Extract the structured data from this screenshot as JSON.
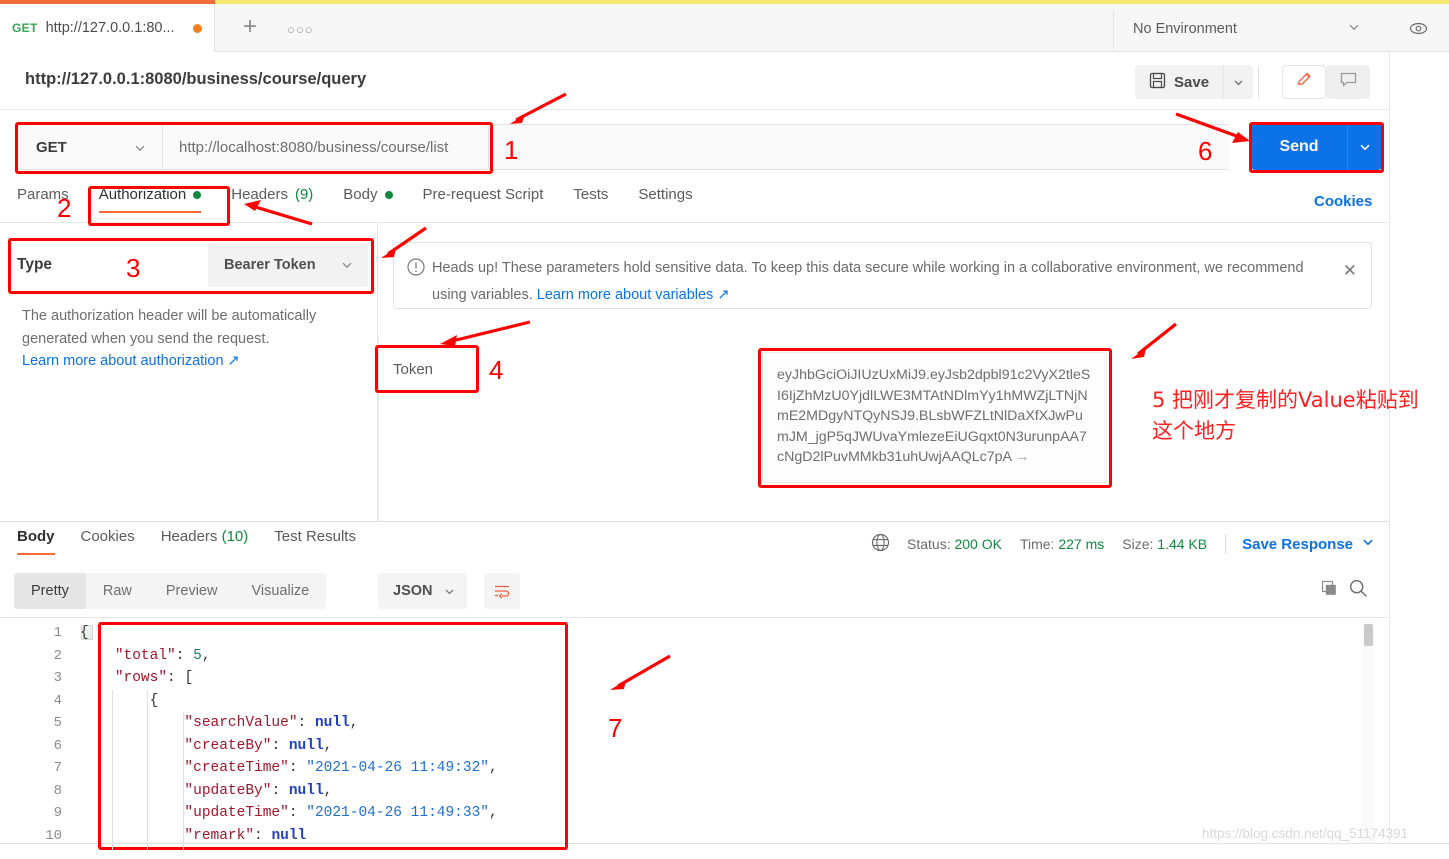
{
  "tab": {
    "method": "GET",
    "name": "http://127.0.0.1:80...",
    "plus_icon": "plus-icon",
    "more_icon": "more-horizontal-icon"
  },
  "environment": {
    "selected": "No Environment",
    "eye_icon": "eye-icon"
  },
  "request": {
    "title": "http://127.0.0.1:8080/business/course/query",
    "save_label": "Save",
    "save_icon": "floppy-disk-icon",
    "pencil_icon": "pencil-icon",
    "comment_icon": "comment-icon",
    "code_icon": "code-icon",
    "method": "GET",
    "url": "http://localhost:8080/business/course/list",
    "send_label": "Send"
  },
  "request_tabs": [
    {
      "label": "Params",
      "indicator": "",
      "active": false
    },
    {
      "label": "Authorization",
      "indicator": "dot",
      "active": true
    },
    {
      "label": "Headers",
      "count": "(9)",
      "indicator": "",
      "active": false
    },
    {
      "label": "Body",
      "indicator": "dot",
      "active": false
    },
    {
      "label": "Pre-request Script",
      "indicator": "",
      "active": false
    },
    {
      "label": "Tests",
      "indicator": "",
      "active": false
    },
    {
      "label": "Settings",
      "indicator": "",
      "active": false
    }
  ],
  "cookies_link": "Cookies",
  "authorization": {
    "type_label": "Type",
    "type_value": "Bearer Token",
    "description": "The authorization header will be automatically generated when you send the request.",
    "learn_more": "Learn more about authorization ↗",
    "heads_up_prefix": "Heads up! These parameters hold sensitive data. To keep this data secure while working in a collaborative environment, we recommend using variables. ",
    "heads_up_link": "Learn more about variables ↗",
    "warning_icon": "exclamation-circle-icon",
    "close_icon": "close-icon",
    "token_label": "Token",
    "token_value": "eyJhbGciOiJIUzUxMiJ9.eyJsb2dpbl91c2VyX2tleSI6IjZhMzU0YjdlLWE3MTAtNDlmYy1hMWZjLTNjNmE2MDgyNTQyNSJ9.BLsbWFZLtNlDaXfXJwPumJM_jgP5qJWUvaYmlezeEiUGqxt0N3urunpAA7cNgD2lPuvMMkb31uhUwjAAQLc7pA"
  },
  "response": {
    "tabs": [
      {
        "label": "Body",
        "active": true
      },
      {
        "label": "Cookies",
        "active": false
      },
      {
        "label": "Headers",
        "count": "(10)",
        "active": false
      },
      {
        "label": "Test Results",
        "active": false
      }
    ],
    "globe_icon": "globe-icon",
    "status_label": "Status:",
    "status_value": "200 OK",
    "time_label": "Time:",
    "time_value": "227 ms",
    "size_label": "Size:",
    "size_value": "1.44 KB",
    "save_response": "Save Response",
    "formats": [
      {
        "label": "Pretty",
        "active": true
      },
      {
        "label": "Raw",
        "active": false
      },
      {
        "label": "Preview",
        "active": false
      },
      {
        "label": "Visualize",
        "active": false
      }
    ],
    "language": "JSON",
    "wrap_icon": "word-wrap-icon",
    "copy_icon": "copy-icon",
    "search_icon": "search-icon",
    "line_numbers": [
      "1",
      "2",
      "3",
      "4",
      "5",
      "6",
      "7",
      "8",
      "9",
      "10"
    ],
    "body_lines": [
      {
        "indent": 0,
        "content": "{"
      },
      {
        "indent": 1,
        "key": "\"total\"",
        "value": "5",
        "type": "number",
        "trail": ","
      },
      {
        "indent": 1,
        "key": "\"rows\"",
        "value": "[",
        "type": "bracket",
        "trail": ""
      },
      {
        "indent": 2,
        "content": "{"
      },
      {
        "indent": 3,
        "key": "\"searchValue\"",
        "value": "null",
        "type": "null",
        "trail": ","
      },
      {
        "indent": 3,
        "key": "\"createBy\"",
        "value": "null",
        "type": "null",
        "trail": ","
      },
      {
        "indent": 3,
        "key": "\"createTime\"",
        "value": "\"2021-04-26 11:49:32\"",
        "type": "string",
        "trail": ","
      },
      {
        "indent": 3,
        "key": "\"updateBy\"",
        "value": "null",
        "type": "null",
        "trail": ","
      },
      {
        "indent": 3,
        "key": "\"updateTime\"",
        "value": "\"2021-04-26 11:49:33\"",
        "type": "string",
        "trail": ","
      },
      {
        "indent": 3,
        "key": "\"remark\"",
        "value": "null",
        "type": "null",
        "trail": ""
      }
    ]
  },
  "annotations": {
    "n1": "1",
    "n2": "2",
    "n3": "3",
    "n4": "4",
    "n5": "5",
    "n6": "6",
    "n7": "7",
    "cn_note": "5 把刚才复制的Value粘贴到这个地方",
    "color": "#ff0000"
  },
  "watermark": "https://blog.csdn.net/qq_51174391"
}
